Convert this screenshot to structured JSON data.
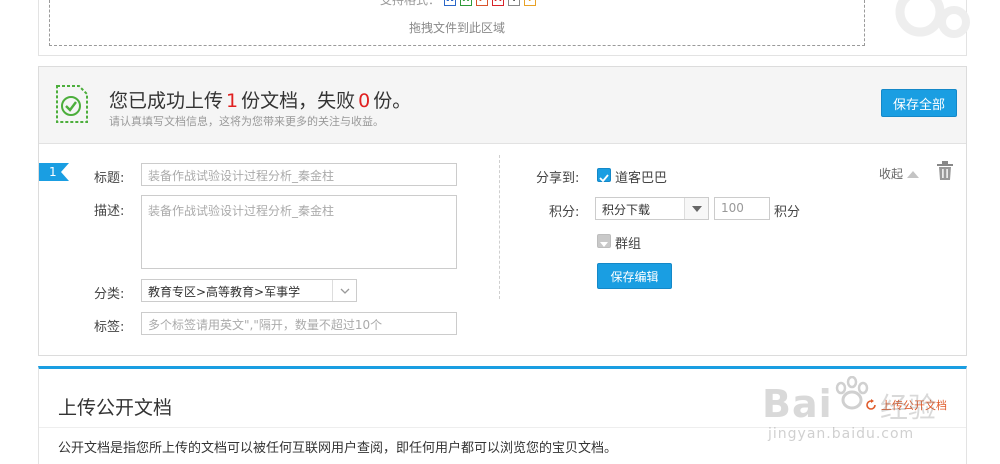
{
  "dropzone": {
    "formats_label": "支持格式：",
    "format_icons": [
      "word-icon",
      "excel-icon",
      "ppt-icon",
      "pdf-icon",
      "txt-icon",
      "other-icon"
    ],
    "hint": "拖拽文件到此区域"
  },
  "summary": {
    "prefix": "您已成功上传",
    "success_count": "1",
    "middle": "份文档，失败",
    "fail_count": "0",
    "suffix": "份。",
    "sub": "请认真填写文档信息，这将为您带来更多的关注与收益。",
    "save_all_label": "保存全部"
  },
  "doc": {
    "index": "1",
    "title_label": "标题:",
    "title_placeholder": "装备作战试验设计过程分析_秦金柱",
    "desc_label": "描述:",
    "desc_placeholder": "装备作战试验设计过程分析_秦金柱",
    "category_label": "分类:",
    "category_value": "教育专区>高等教育>军事学",
    "tags_label": "标签:",
    "tags_placeholder": "多个标签请用英文\",\"隔开，数量不超过10个",
    "share_label": "分享到:",
    "share_target": "道客巴巴",
    "share_checked": true,
    "points_label": "积分:",
    "points_mode": "积分下载",
    "points_value": "100",
    "points_unit": "积分",
    "group_label": "群组",
    "group_checked": false,
    "save_edit_label": "保存编辑",
    "collapse_label": "收起"
  },
  "public_section": {
    "title": "上传公开文档",
    "link_label": "上传公开文档",
    "description": "公开文档是指您所上传的文档可以被任何互联网用户查阅，即任何用户都可以浏览您的宝贝文档。"
  },
  "watermark": {
    "brand": "Bai",
    "brand_tail": "经验",
    "url": "jingyan.baidu.com"
  },
  "colors": {
    "accent": "#1a9ee2",
    "danger": "#e02020",
    "success": "#4cae3c"
  }
}
